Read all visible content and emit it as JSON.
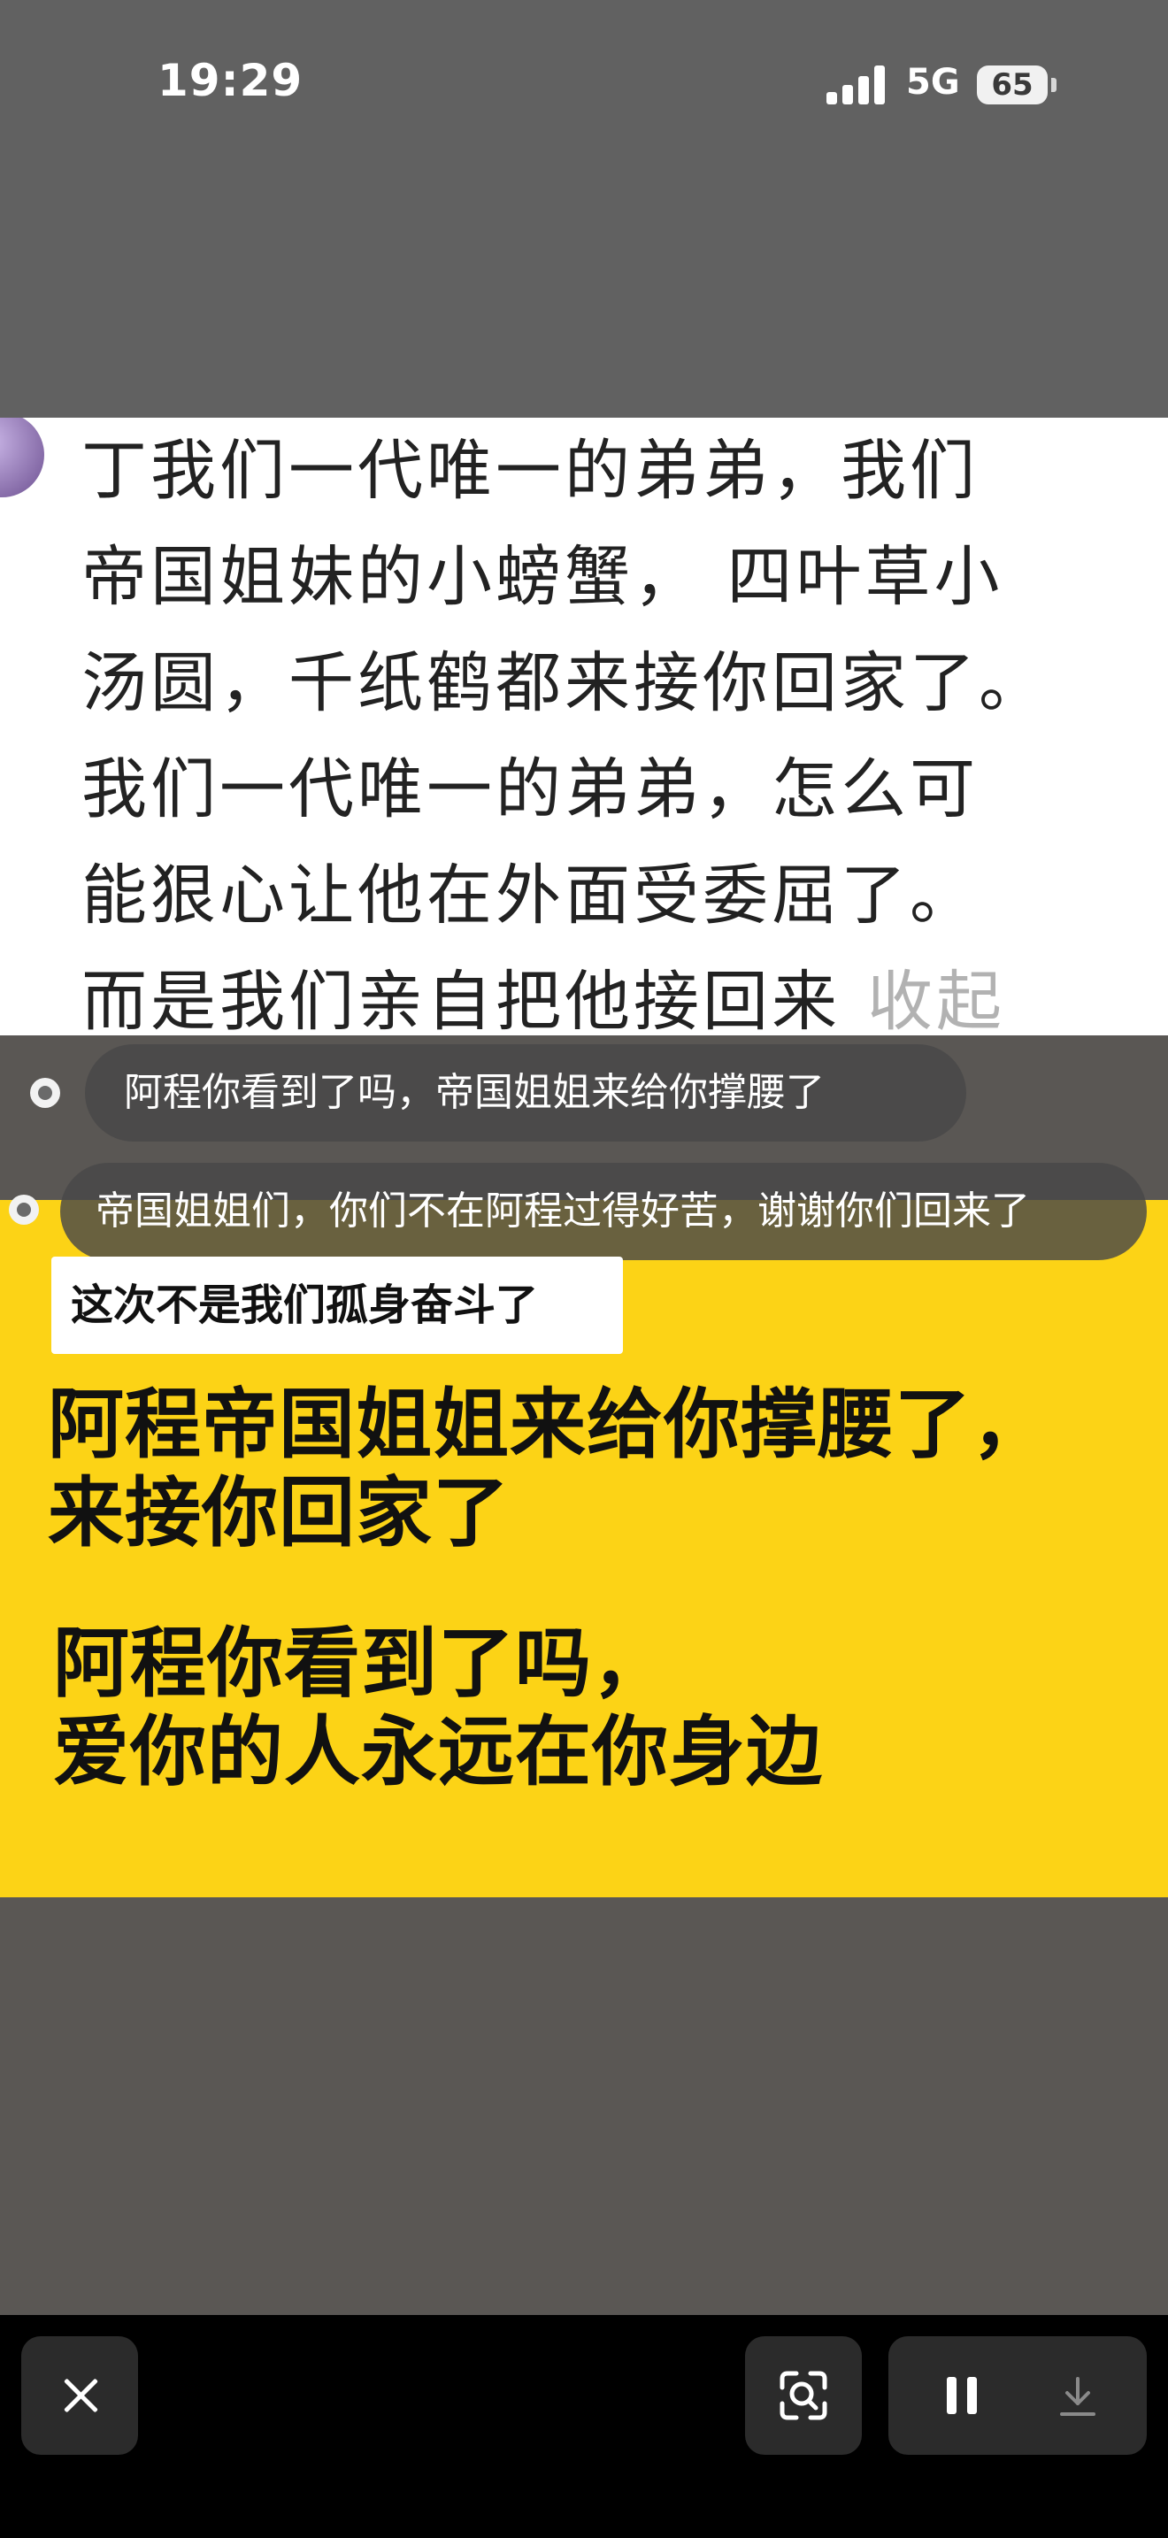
{
  "status_bar": {
    "time": "19:29",
    "network": "5G",
    "battery": "65"
  },
  "comment": {
    "lines": [
      "丁我们一代唯一的弟弟，我们",
      "帝国姐妹的小螃蟹， 四叶草小",
      "汤圆，千纸鹤都来接你回家了。",
      "我们一代唯一的弟弟，怎么可",
      "能狠心让他在外面受委屈了。",
      "而是我们亲自把他接回来"
    ],
    "collapse_label": "收起"
  },
  "danmaku": [
    "阿程你看到了吗，帝国姐姐来给你撑腰了",
    "帝国姐姐们，你们不在阿程过得好苦，谢谢你们回来了"
  ],
  "video": {
    "label": "这次不是我们孤身奋斗了",
    "big_text_1": [
      "阿程帝国姐姐来给你撑腰了，",
      "来接你回家了"
    ],
    "big_text_2": [
      "阿程你看到了吗，",
      "爱你的人永远在你身边"
    ]
  },
  "bottom_bar": {
    "icons": [
      "close-icon",
      "visual-search-icon",
      "pause-icon",
      "download-icon"
    ]
  }
}
